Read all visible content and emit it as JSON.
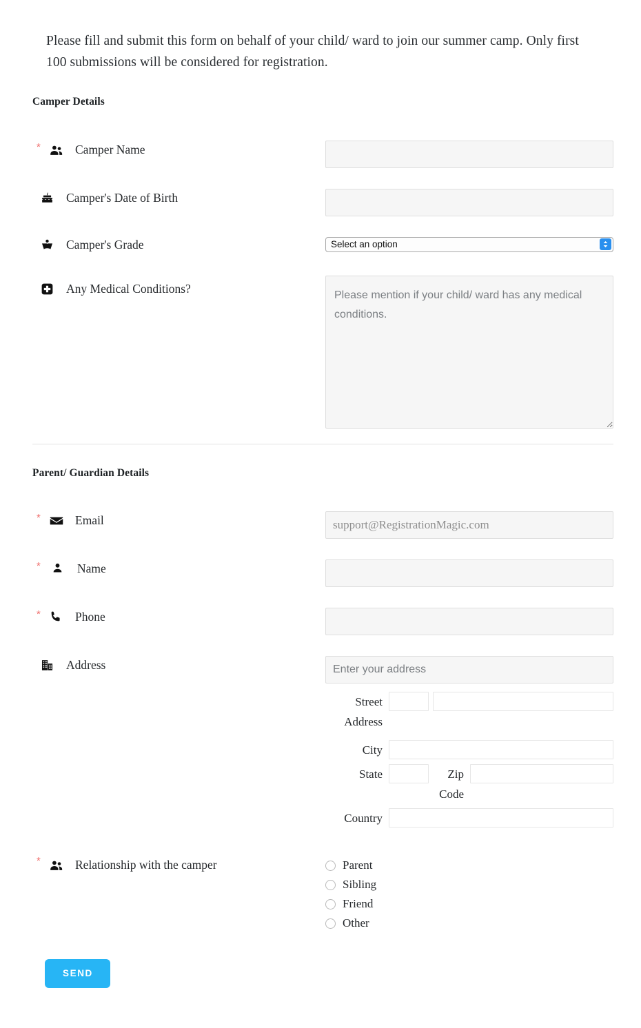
{
  "intro": {
    "line1": "Please fill and submit this form on behalf of your child/ ward to join our summer camp.",
    "line2": "Only first 100 submissions will be considered for registration."
  },
  "sections": [
    {
      "title": "Camper Details"
    },
    {
      "title": "Parent/ Guardian Details"
    }
  ],
  "camper": {
    "name": {
      "label": "Camper Name",
      "icon": "people-icon",
      "required": true,
      "value": "",
      "placeholder": ""
    },
    "dob": {
      "label": "Camper's Date of Birth",
      "icon": "birthday-cake-icon",
      "required": false,
      "value": "",
      "placeholder": ""
    },
    "grade": {
      "label": "Camper's Grade",
      "icon": "open-book-icon",
      "required": false,
      "selected": "Select an option",
      "options": [
        "Select an option"
      ]
    },
    "medical": {
      "label": "Any Medical Conditions?",
      "icon": "medical-cross-icon",
      "required": false,
      "value": "",
      "placeholder": "Please mention if your child/ ward has any medical conditions."
    }
  },
  "parent": {
    "email": {
      "label": "Email",
      "icon": "envelope-icon",
      "required": true,
      "value": "",
      "placeholder": "support@RegistrationMagic.com"
    },
    "name": {
      "label": "Name",
      "icon": "person-icon",
      "required": true,
      "value": "",
      "placeholder": ""
    },
    "phone": {
      "label": "Phone",
      "icon": "phone-icon",
      "required": true,
      "value": "",
      "placeholder": ""
    },
    "address": {
      "label": "Address",
      "icon": "building-icon",
      "required": false,
      "value": "",
      "placeholder": "Enter your address",
      "fields": {
        "street": {
          "label": "Street Address",
          "value": ""
        },
        "city": {
          "label": "City",
          "value": ""
        },
        "state": {
          "label": "State",
          "value": ""
        },
        "zip": {
          "label": "Zip Code",
          "value": ""
        },
        "country": {
          "label": "Country",
          "value": ""
        }
      }
    },
    "relationship": {
      "label": "Relationship with the camper",
      "icon": "people-icon",
      "required": true,
      "selected": null,
      "options": [
        "Parent",
        "Sibling",
        "Friend",
        "Other"
      ]
    }
  },
  "submit": {
    "label": "SEND"
  },
  "colors": {
    "accent": "#27b5f5",
    "required_star": "#f0706e",
    "input_bg": "#f6f6f6",
    "input_border": "#dedede",
    "select_stepper": "#2a8fee"
  },
  "required_marker": "*"
}
